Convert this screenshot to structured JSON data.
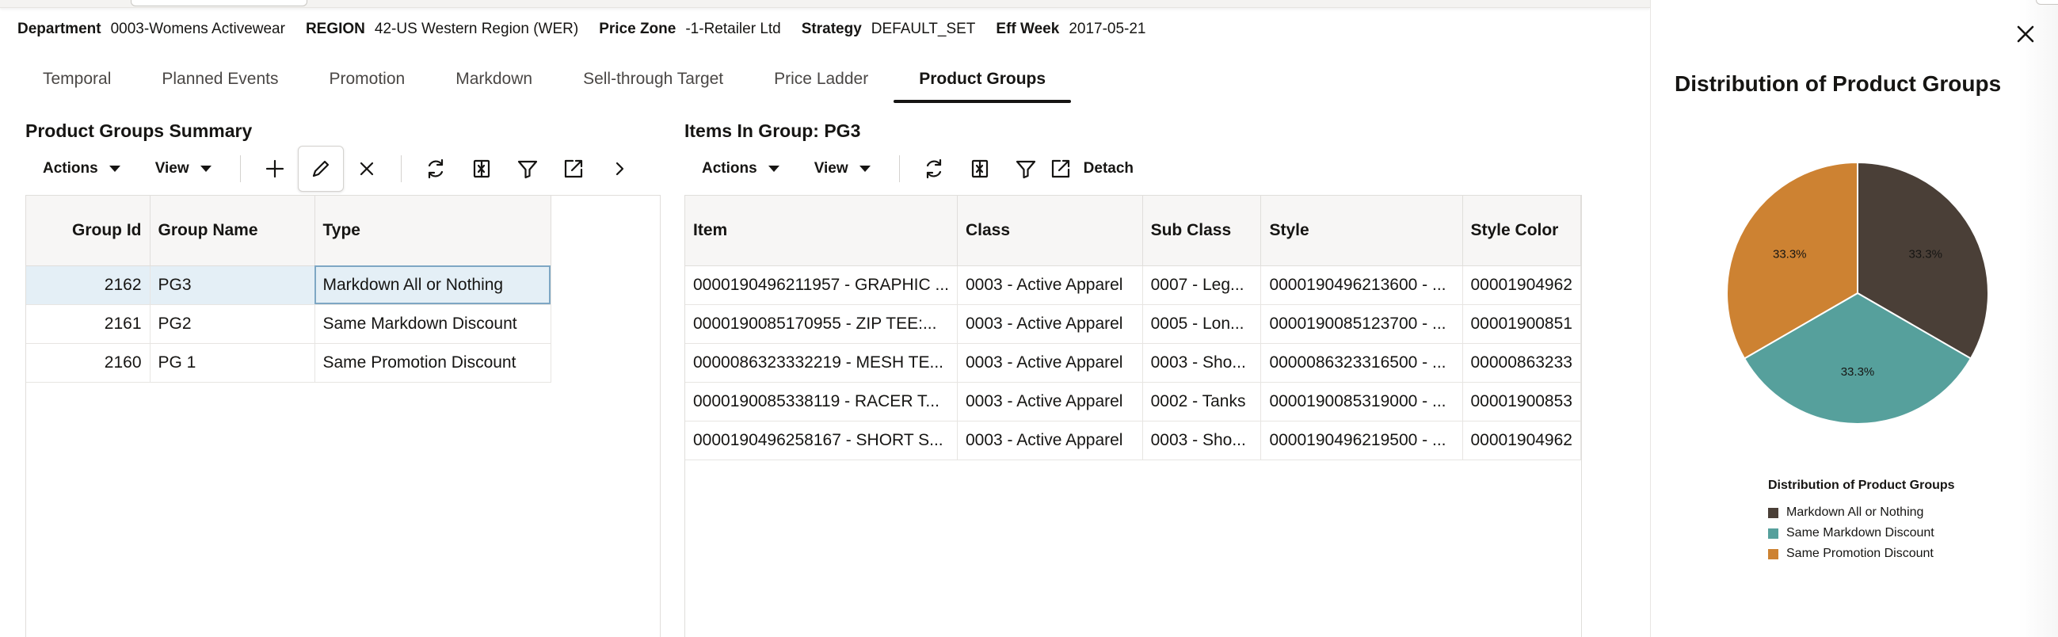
{
  "context": {
    "department_label": "Department",
    "department_value": "0003-Womens Activewear",
    "region_label": "REGION",
    "region_value": "42-US Western Region (WER)",
    "price_zone_label": "Price Zone",
    "price_zone_value": "-1-Retailer Ltd",
    "strategy_label": "Strategy",
    "strategy_value": "DEFAULT_SET",
    "eff_week_label": "Eff Week",
    "eff_week_value": "2017-05-21"
  },
  "tabs": [
    {
      "label": "Temporal"
    },
    {
      "label": "Planned Events"
    },
    {
      "label": "Promotion"
    },
    {
      "label": "Markdown"
    },
    {
      "label": "Sell-through Target"
    },
    {
      "label": "Price Ladder"
    },
    {
      "label": "Product Groups"
    }
  ],
  "summary": {
    "title": "Product Groups Summary",
    "actions_label": "Actions",
    "view_label": "View",
    "columns": [
      "Group Id",
      "Group Name",
      "Type"
    ],
    "rows": [
      [
        "2162",
        "PG3",
        "Markdown All or Nothing"
      ],
      [
        "2161",
        "PG2",
        "Same Markdown Discount"
      ],
      [
        "2160",
        "PG 1",
        "Same Promotion Discount"
      ]
    ]
  },
  "items": {
    "title": "Items In Group: PG3",
    "actions_label": "Actions",
    "view_label": "View",
    "detach_label": "Detach",
    "columns": [
      "Item",
      "Class",
      "Sub Class",
      "Style",
      "Style Color"
    ],
    "rows": [
      [
        "0000190496211957 - GRAPHIC ...",
        "0003 - Active Apparel",
        "0007 - Leg...",
        "0000190496213600 - ...",
        "00001904962"
      ],
      [
        "0000190085170955 - ZIP TEE:...",
        "0003 - Active Apparel",
        "0005 - Lon...",
        "0000190085123700 - ...",
        "00001900851"
      ],
      [
        "0000086323332219 - MESH TE...",
        "0003 - Active Apparel",
        "0003 - Sho...",
        "0000086323316500 - ...",
        "00000863233"
      ],
      [
        "0000190085338119 - RACER T...",
        "0003 - Active Apparel",
        "0002 - Tanks",
        "0000190085319000 - ...",
        "00001900853"
      ],
      [
        "0000190496258167 - SHORT S...",
        "0003 - Active Apparel",
        "0003 - Sho...",
        "0000190496219500 - ...",
        "00001904962"
      ]
    ]
  },
  "side": {
    "title": "Distribution of Product Groups"
  },
  "chart_data": {
    "type": "pie",
    "title": "Distribution of Product Groups",
    "categories": [
      "Markdown All or Nothing",
      "Same Markdown Discount",
      "Same Promotion Discount"
    ],
    "values": [
      33.3,
      33.3,
      33.3
    ],
    "data_labels": [
      "33.3%",
      "33.3%",
      "33.3%"
    ],
    "colors": [
      "#4a3f37",
      "#56a09c",
      "#cd8232"
    ],
    "legend_title": "Distribution of Product Groups",
    "legend_position": "bottom"
  }
}
